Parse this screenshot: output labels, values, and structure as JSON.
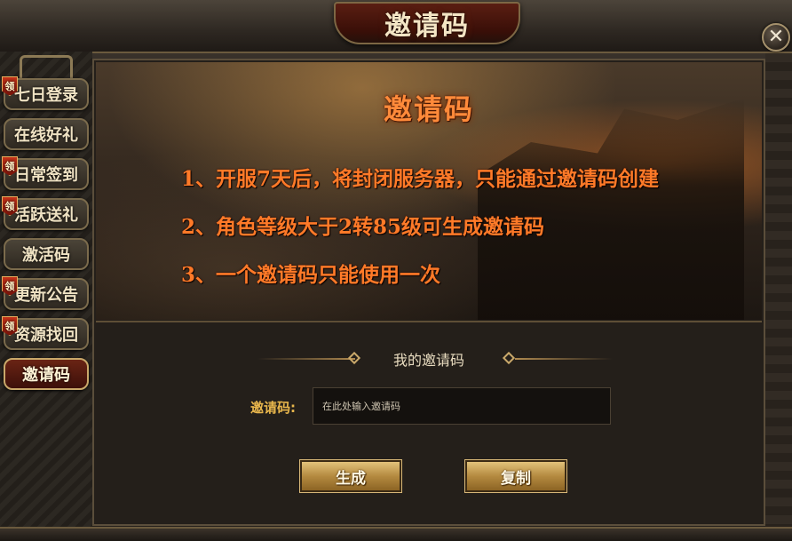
{
  "window": {
    "title": "邀请码",
    "close_icon": "close-icon",
    "close_glyph": "✕"
  },
  "sidebar": {
    "items": [
      {
        "label": "七日登录",
        "badge": "领",
        "active": false
      },
      {
        "label": "在线好礼",
        "badge": "",
        "active": false
      },
      {
        "label": "日常签到",
        "badge": "领",
        "active": false
      },
      {
        "label": "活跃送礼",
        "badge": "领",
        "active": false
      },
      {
        "label": "激活码",
        "badge": "",
        "active": false
      },
      {
        "label": "更新公告",
        "badge": "领",
        "active": false
      },
      {
        "label": "资源找回",
        "badge": "领",
        "active": false
      },
      {
        "label": "邀请码",
        "badge": "",
        "active": true
      }
    ]
  },
  "banner": {
    "title": "邀请码",
    "rules": [
      "1、开服7天后，将封闭服务器，只能通过邀请码创建",
      "2、角色等级大于2转85级可生成邀请码",
      "3、一个邀请码只能使用一次"
    ]
  },
  "my_code": {
    "section_title": "我的邀请码",
    "label": "邀请码:",
    "placeholder": "在此处输入邀请码",
    "value": ""
  },
  "buttons": {
    "generate": "生成",
    "copy": "复制"
  },
  "colors": {
    "rule_text": "#ff7a28",
    "label_gold": "#e8b64c",
    "button_gold": "#b48a40",
    "active_tab": "#6a2414"
  }
}
